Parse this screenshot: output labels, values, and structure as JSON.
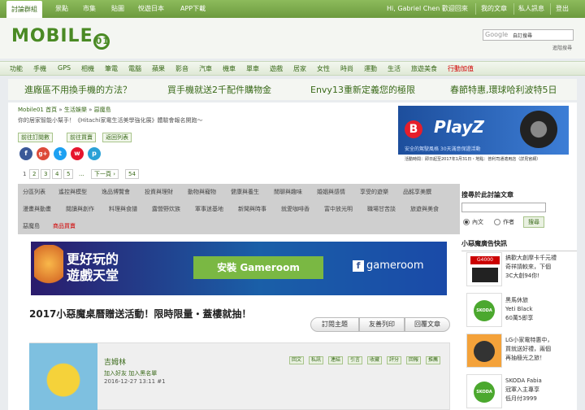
{
  "topnav": {
    "items": [
      "討論群組",
      "景點",
      "市集",
      "貼圖",
      "悅遊日本",
      "APP下載"
    ],
    "greeting": "Hi, Gabriel Chen 歡迎回來",
    "right": [
      "我的文章",
      "私人訊息",
      "登出"
    ]
  },
  "header": {
    "logo": "MOBILE",
    "logo_badge": "01",
    "search_brand": "Google",
    "search_value": "自訂搜尋",
    "advanced": "進階搜尋"
  },
  "catnav": [
    "功能",
    "手機",
    "GPS",
    "相機",
    "筆電",
    "電腦",
    "蘋果",
    "影音",
    "汽車",
    "機車",
    "單車",
    "遊戲",
    "居家",
    "女性",
    "時尚",
    "運動",
    "生活",
    "旅遊美食",
    "行動加值"
  ],
  "promo": [
    "進廠區不用換手機的方法？",
    "買手機就送2千配件購物金",
    "Envy13重新定義您的極限",
    "春節特惠,環球哈利波特5日"
  ],
  "breadcrumb": {
    "home": "Mobile01 首頁",
    "sep": " » ",
    "cat": "生活娛樂",
    "forum": "惡魔島"
  },
  "subline": "你的居家智能小幫手！《Hitachi家電生活美學強化展》體驗會報名開跑～",
  "actions": [
    "前往訂閱數",
    "前往買賣",
    "返回列表"
  ],
  "social": [
    "f",
    "g+",
    "t",
    "w",
    "p"
  ],
  "pager": [
    "1",
    "2",
    "3",
    "4",
    "5",
    "...",
    "下一頁 ›",
    "54"
  ],
  "ad": {
    "brand": "B",
    "name": "PlayZ",
    "tag": "安全的駕駛風格 30天滿意保證活動",
    "footer": "活動時間：即日起至2017年1月31日・地點：普利司通適用店（詳見官網）"
  },
  "categories": {
    "row1": [
      "分區列表",
      "遙控與模型",
      "逸品博覽會",
      "投資與理財",
      "動物與寵物",
      "健康與養生",
      "閒聊與趣味",
      "婚姻與感情",
      "享受的遊樂",
      "品酩享美饌"
    ],
    "row2": [
      "漫畫與動畫",
      "閱讀與創作",
      "料理與食譜",
      "露營野炊族",
      "軍事迷基地",
      "新聞與時事",
      "就愛咖啡香",
      "富中放光明",
      "職場甘苦談",
      "旅遊與美食"
    ],
    "row3": [
      "惡魔島",
      "商品買賣"
    ]
  },
  "gameroom": {
    "headline1": "更好玩的",
    "headline2": "遊戲天堂",
    "install": "安裝 Gameroom",
    "brand": "gameroom"
  },
  "thread": {
    "title": "2017小惡魔桌曆贈送活動！限時限量・蓋樓就抽！",
    "buttons": [
      "訂閱主題",
      "友善列印",
      "回覆文章"
    ]
  },
  "post": {
    "author": "吉姆林",
    "actions": "加入好友  加入黑名單",
    "date": "2016-12-27 13:11  #1",
    "buttons": [
      "回文",
      "私訊",
      "連結",
      "引言",
      "收藏",
      "評分",
      "回報",
      "推薦"
    ]
  },
  "sidebar": {
    "search_title": "搜尋於此討論文章",
    "radio_content": "內文",
    "radio_author": "作者",
    "search_button": "搜尋",
    "ads_title": "小惡魔廣告快訊",
    "ads": [
      {
        "lines": [
          "搞歡大創摩卡千元禮",
          "奇祥請較來，下個",
          "3C大創94你!"
        ],
        "img": "G4000"
      },
      {
        "lines": [
          "黑馬休旅",
          "Yeti Black",
          "60萬5即享"
        ],
        "img": "SKODA"
      },
      {
        "lines": [
          "LG小家電特惠中，",
          "買就送好禮，兩個",
          "再抽極光之旅！"
        ],
        "img": ""
      },
      {
        "lines": [
          "SKODA Fabia",
          "冠軍入主專享",
          "低月付3999"
        ],
        "img": "SKODA"
      }
    ]
  }
}
